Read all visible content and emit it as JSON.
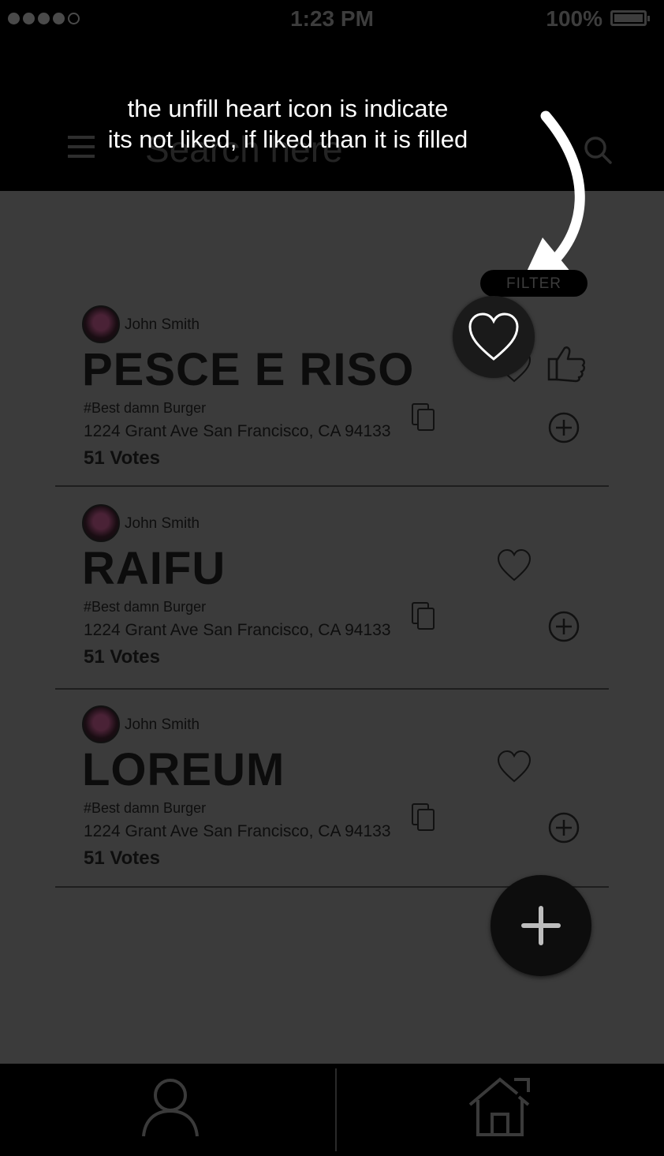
{
  "status_bar": {
    "time": "1:23 PM",
    "battery": "100%"
  },
  "header": {
    "search_placeholder": "Search here"
  },
  "annotation": {
    "line1": "the unfill heart icon is indicate",
    "line2": "its not liked, if liked than it is filled"
  },
  "filter": {
    "label": "FILTER"
  },
  "cards": [
    {
      "author": "John Smith",
      "title": "PESCE E RISO",
      "tag": "#Best damn Burger",
      "address": "1224 Grant Ave San Francisco, CA 94133",
      "votes": "51 Votes"
    },
    {
      "author": "John Smith",
      "title": "RAIFU",
      "tag": "#Best damn Burger",
      "address": "1224 Grant Ave San Francisco, CA 94133",
      "votes": "51 Votes"
    },
    {
      "author": "John Smith",
      "title": "LOREUM",
      "tag": "#Best damn Burger",
      "address": "1224 Grant Ave San Francisco, CA 94133",
      "votes": "51 Votes"
    }
  ],
  "icons": {
    "heart": "heart-outline-icon",
    "like": "thumbs-up-icon",
    "add": "plus-circle-icon",
    "copy": "copy-icon",
    "fab": "plus-icon",
    "nav_profile": "user-icon",
    "nav_home": "home-icon"
  },
  "colors": {
    "background": "#3b3b3b",
    "header": "#000000",
    "text": "#0c0c0c",
    "annotation": "#ffffff"
  }
}
